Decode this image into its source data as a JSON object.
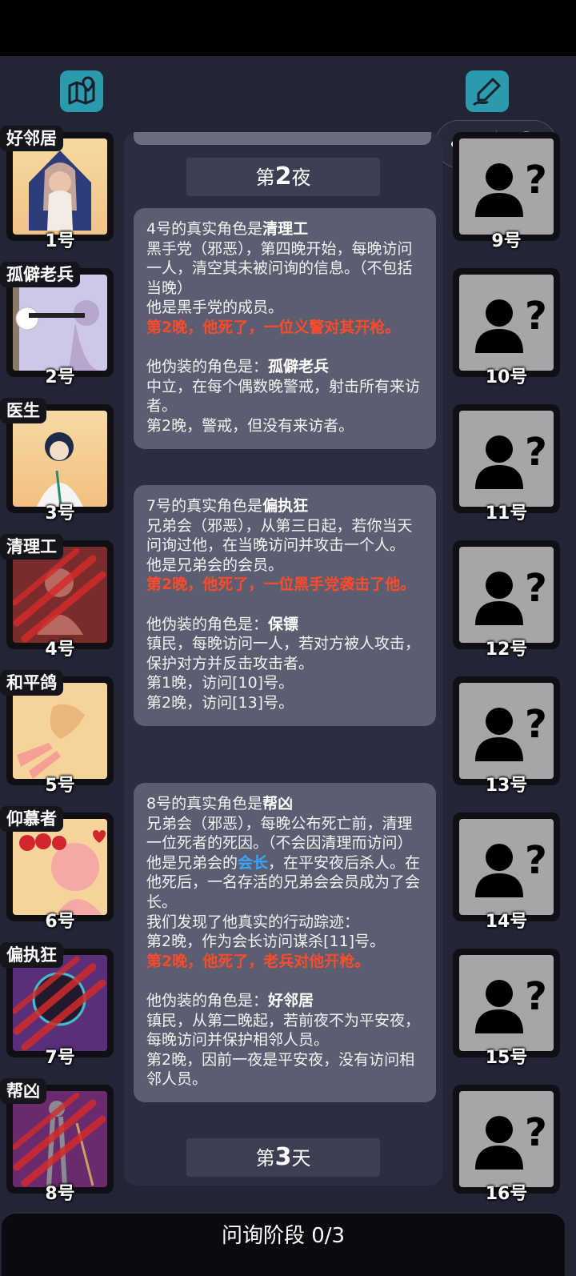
{
  "left_players": [
    {
      "role": "好邻居",
      "number": "1号"
    },
    {
      "role": "孤僻老兵",
      "number": "2号"
    },
    {
      "role": "医生",
      "number": "3号"
    },
    {
      "role": "清理工",
      "number": "4号"
    },
    {
      "role": "和平鸽",
      "number": "5号"
    },
    {
      "role": "仰慕者",
      "number": "6号"
    },
    {
      "role": "偏执狂",
      "number": "7号"
    },
    {
      "role": "帮凶",
      "number": "8号"
    }
  ],
  "right_players": [
    {
      "number": "9号"
    },
    {
      "number": "10号"
    },
    {
      "number": "11号"
    },
    {
      "number": "12号"
    },
    {
      "number": "13号"
    },
    {
      "number": "14号"
    },
    {
      "number": "15号"
    },
    {
      "number": "16号"
    }
  ],
  "log": {
    "night_title": {
      "prefix": "第",
      "num": "2",
      "suffix": "夜"
    },
    "day_title": {
      "prefix": "第",
      "num": "3",
      "suffix": "天"
    },
    "msg1": {
      "l1a": "4号的真实角色是",
      "l1b": "清理工",
      "l2": "黑手党（邪恶），第四晚开始，每晚访问一人，清空其未被问询的信息。（不包括当晚）",
      "l3": "他是黑手党的成员。",
      "l4": "第2晚，他死了，一位义警对其开枪。",
      "l5a": "他伪装的角色是：",
      "l5b": "孤僻老兵",
      "l6": "中立，在每个偶数晚警戒，射击所有来访者。",
      "l7": "第2晚，警戒，但没有来访者。"
    },
    "msg2": {
      "l1a": "7号的真实角色是",
      "l1b": "偏执狂",
      "l2": "兄弟会（邪恶），从第三日起，若你当天问询过他，在当晚访问并攻击一个人。",
      "l3": "他是兄弟会的会员。",
      "l4": "第2晚，他死了，一位黑手党袭击了他。",
      "l5a": "他伪装的角色是：",
      "l5b": "保镖",
      "l6": "镇民，每晚访问一人，若对方被人攻击，保护对方并反击攻击者。",
      "l7": "第1晚，访问[10]号。",
      "l8": "第2晚，访问[13]号。"
    },
    "msg3": {
      "l1a": "8号的真实角色是",
      "l1b": "帮凶",
      "l2": "兄弟会（邪恶），每晚公布死亡前，清理一位死者的死因。（不会因清理而访问）",
      "l3a": "他是兄弟会的",
      "l3b": "会长",
      "l3c": "，在平安夜后杀人。在他死后，一名存活的兄弟会会员成为了会长。",
      "l4": "我们发现了他真实的行动踪迹：",
      "l5": "第2晚，作为会长访问谋杀[11]号。",
      "l6": "第2晚，他死了，老兵对他开枪。",
      "l7a": "他伪装的角色是：",
      "l7b": "好邻居",
      "l8": "镇民，从第二晚起，若前夜不为平安夜，每晚访问并保护相邻人员。",
      "l9": "第2晚，因前一夜是平安夜，没有访问相邻人员。"
    }
  },
  "bottom_bar": {
    "label": "问询阶段 0/3"
  },
  "colors": {
    "background": "#222536",
    "icon_teal": "#2a9bad",
    "dead_text": "#ff4a2a",
    "leader_link": "#39a5ff"
  },
  "icons": {
    "map": "map-pin-icon",
    "edit": "pen-edit-icon",
    "more": "more-dots-icon",
    "close": "target-circle-icon",
    "unknown": "unknown-person-icon"
  }
}
